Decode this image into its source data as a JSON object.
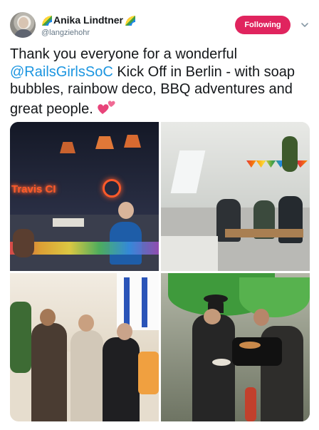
{
  "header": {
    "display_name": "Anika Lindtner",
    "handle": "@langziehohr",
    "follow_label": "Following",
    "follow_color": "#e0245e",
    "icons": [
      "rainbow-icon",
      "rainbow-icon",
      "chevron-down-icon"
    ]
  },
  "tweet": {
    "text_before": "Thank you everyone for a wonderful ",
    "mention": "@RailsGirlsSoC",
    "text_after": " Kick Off in Berlin - with soap bubbles, rainbow deco, BBQ adventures and great people. ",
    "emoji": "two-hearts-icon",
    "mention_color": "#1b95e0"
  },
  "media": {
    "photos": [
      "photo-1",
      "photo-2",
      "photo-3",
      "photo-4"
    ],
    "neon_sign": "Travis CI"
  }
}
